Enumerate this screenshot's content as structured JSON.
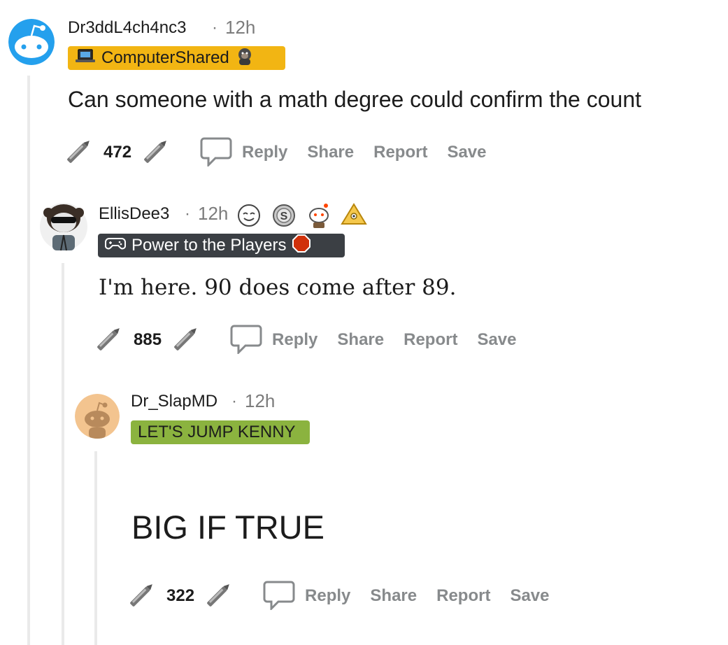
{
  "colors": {
    "flair_gold": "#f2b513",
    "flair_dark": "#3b3f44",
    "flair_green": "#8bb33f",
    "action_gray": "#878a8c",
    "thread_line": "#eaeaea"
  },
  "comments": [
    {
      "username": "Dr3ddL4ch4nc3",
      "separator": "·",
      "time": "12h",
      "flair": "ComputerShared",
      "flair_icons": [
        "laptop-icon",
        "gorilla-icon"
      ],
      "body": "Can someone with a math degree could confirm the count",
      "score": "472",
      "actions": {
        "reply": "Reply",
        "share": "Share",
        "report": "Report",
        "save": "Save"
      }
    },
    {
      "username": "EllisDee3",
      "separator": "·",
      "time": "12h",
      "awards": [
        "smile-award-icon",
        "silver-award-icon",
        "snoo-award-icon",
        "gold-triangle-award-icon"
      ],
      "flair": "Power to the Players",
      "flair_icons": [
        "gamepad-icon",
        "stop-sign-icon"
      ],
      "body": "I'm here. 90 does come after 89.",
      "score": "885",
      "actions": {
        "reply": "Reply",
        "share": "Share",
        "report": "Report",
        "save": "Save"
      }
    },
    {
      "username": "Dr_SlapMD",
      "separator": "·",
      "time": "12h",
      "flair": "LET'S JUMP KENNY",
      "body": "BIG IF TRUE",
      "score": "322",
      "actions": {
        "reply": "Reply",
        "share": "Share",
        "report": "Report",
        "save": "Save"
      }
    }
  ]
}
